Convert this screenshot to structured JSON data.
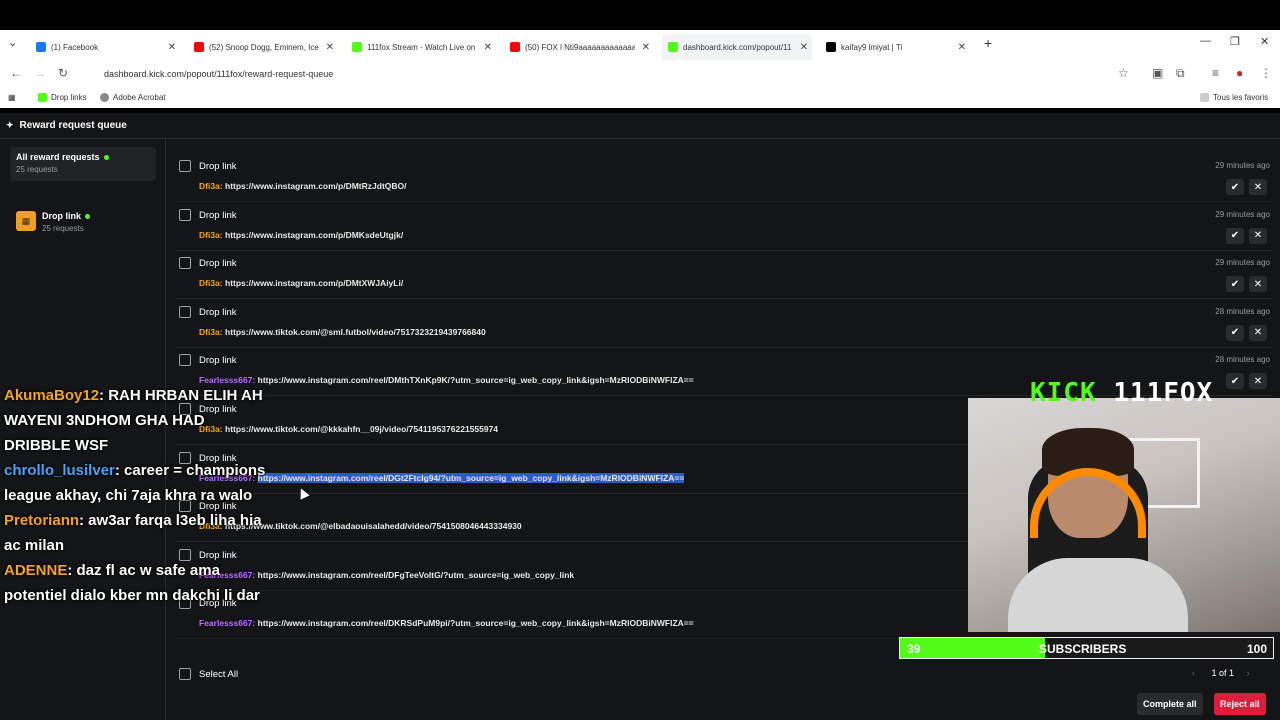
{
  "browser": {
    "tabs": [
      {
        "title": "(1) Facebook",
        "favicon_color": "#1877f2"
      },
      {
        "title": "(52) Snoop Dogg, Eminem, Ice",
        "favicon_color": "#ff0000"
      },
      {
        "title": "111fox Stream - Watch Live on",
        "favicon_color": "#53fc18"
      },
      {
        "title": "(50) FOX l Nti9aaaaaaaaaaaaaa",
        "favicon_color": "#ff0000"
      },
      {
        "title": "dashboard.kick.com/popout/11",
        "favicon_color": "#53fc18"
      },
      {
        "title": "kaifay9 lmiyat | Ti",
        "favicon_color": "#000000"
      }
    ],
    "url": "dashboard.kick.com/popout/111fox/reward-request-queue",
    "bookmarks": [
      "Drop links",
      "Adobe Acrobat"
    ],
    "all_bookmarks": "Tous les favoris"
  },
  "app": {
    "title": "Reward request queue",
    "sidebar": {
      "all": {
        "title": "All reward requests",
        "count": "25 requests"
      },
      "drop": {
        "title": "Drop link",
        "count": "25 requests"
      }
    },
    "requests": [
      {
        "label": "Drop link",
        "user": "Dfi3a:",
        "user_color": "#f5a524",
        "link": "https://www.instagram.com/p/DMtRzJdtQBO/",
        "time": "29 minutes ago"
      },
      {
        "label": "Drop link",
        "user": "Dfi3a:",
        "user_color": "#f5a524",
        "link": "https://www.instagram.com/p/DMKsdeUtgjk/",
        "time": "29 minutes ago"
      },
      {
        "label": "Drop link",
        "user": "Dfi3a:",
        "user_color": "#f5a524",
        "link": "https://www.instagram.com/p/DMtXWJAiyLi/",
        "time": "29 minutes ago"
      },
      {
        "label": "Drop link",
        "user": "Dfi3a:",
        "user_color": "#f5a524",
        "link": "https://www.tiktok.com/@sml.futbol/video/7517323219439766840",
        "time": "28 minutes ago"
      },
      {
        "label": "Drop link",
        "user": "Fearlesss667:",
        "user_color": "#b66dff",
        "link": "https://www.instagram.com/reel/DMthTXnKp9K/?utm_source=ig_web_copy_link&igsh=MzRlODBiNWFlZA==",
        "time": "28 minutes ago"
      },
      {
        "label": "Drop link",
        "user": "Dfi3a:",
        "user_color": "#f5a524",
        "link": "https://www.tiktok.com/@kkkahfn__09j/video/7541195376221555974",
        "time": ""
      },
      {
        "label": "Drop link",
        "user": "Fearlesss667:",
        "user_color": "#b66dff",
        "link": "https://www.instagram.com/reel/DGt2FtcIg94/?utm_source=ig_web_copy_link&igsh=MzRlODBiNWFlZA==",
        "time": ""
      },
      {
        "label": "Drop link",
        "user": "Dfi3a:",
        "user_color": "#f5a524",
        "link": "https://www.tiktok.com/@elbadaouisalahedd/video/7541508046443334930",
        "time": ""
      },
      {
        "label": "Drop link",
        "user": "Fearlesss667:",
        "user_color": "#b66dff",
        "link": "https://www.instagram.com/reel/DFgTeeVoItG/?utm_source=ig_web_copy_link",
        "time": ""
      },
      {
        "label": "Drop link",
        "user": "Fearlesss667:",
        "user_color": "#b66dff",
        "link": "https://www.instagram.com/reel/DKRSdPuM9pi/?utm_source=ig_web_copy_link&igsh=MzRlODBiNWFlZA==",
        "time": ""
      }
    ],
    "footer": {
      "select_all": "Select All",
      "pager": "1 of 1",
      "complete_all": "Complete all",
      "reject_all": "Reject all"
    }
  },
  "overlay": {
    "chat": [
      {
        "user": "AkumaBoy12",
        "color": "#f5a524",
        "text": ": RAH HRBAN ELIH AH WAYENI 3NDHOM GHA HAD DRIBBLE WSF"
      },
      {
        "user": "chrollo_lusilver",
        "color": "#4aa3ff",
        "text": ": career = champions league akhay, chi 7aja khra ra walo"
      },
      {
        "user": "Pretoriann",
        "color": "#f5a524",
        "text": ": aw3ar farqa l3eb liha hia ac milan"
      },
      {
        "user": "ADENNE",
        "color": "#f5a524",
        "text": ": daz fl ac w safe ama potentiel dialo kber mn dakchi li dar"
      }
    ],
    "brand": "KICK 111FOX",
    "subs": {
      "current": "39",
      "label": "SUBSCRIBERS",
      "goal": "100",
      "progress_pct": 39
    }
  }
}
